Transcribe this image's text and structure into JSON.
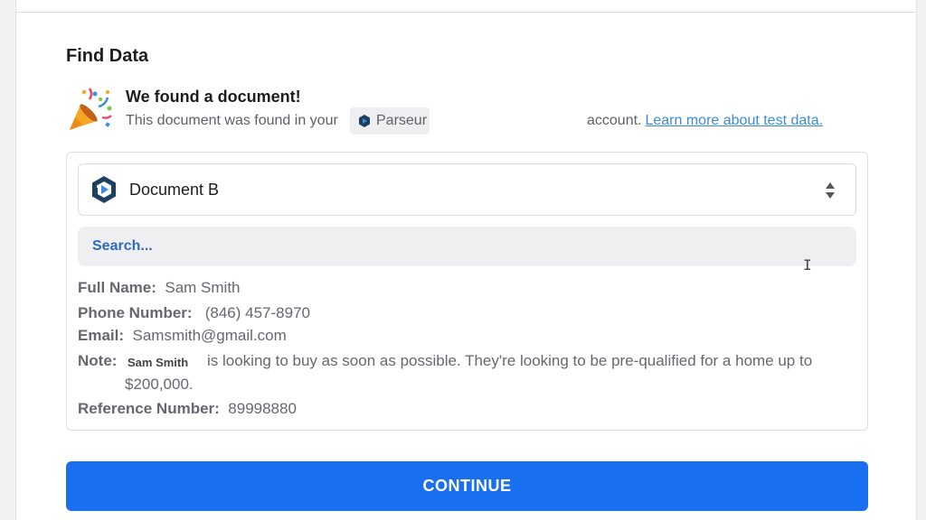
{
  "section_title": "Find Data",
  "found": {
    "title": "We found a document!",
    "prefix": "This document was found in your",
    "app_name": "Parseur",
    "suffix": "account.",
    "link_text": "Learn more about test data."
  },
  "document_select": {
    "selected": "Document B"
  },
  "search": {
    "placeholder": "Search..."
  },
  "fields": {
    "full_name_label": "Full Name:",
    "full_name_value": "Sam Smith",
    "phone_label": "Phone Number:",
    "phone_value": "(846) 457-8970",
    "email_label": "Email:",
    "email_value": "Samsmith@gmail.com",
    "note_label": "Note:",
    "note_name_chip": "Sam Smith",
    "note_line1": "is looking to buy as soon as possible. They're looking to be pre-qualified for a home up to",
    "note_line2": "$200,000.",
    "reference_label": "Reference Number:",
    "reference_value": "89998880"
  },
  "continue_label": "CONTINUE",
  "colors": {
    "accent": "#1a6ff0",
    "link": "#3d8bd8",
    "parseur_dark": "#1f3f5f",
    "parseur_blue": "#3a8de0"
  },
  "icons": {
    "party": "party-popper-icon",
    "parseur": "parseur-logo-icon",
    "sort": "sort-arrows-icon",
    "cursor": "text-cursor-icon"
  }
}
